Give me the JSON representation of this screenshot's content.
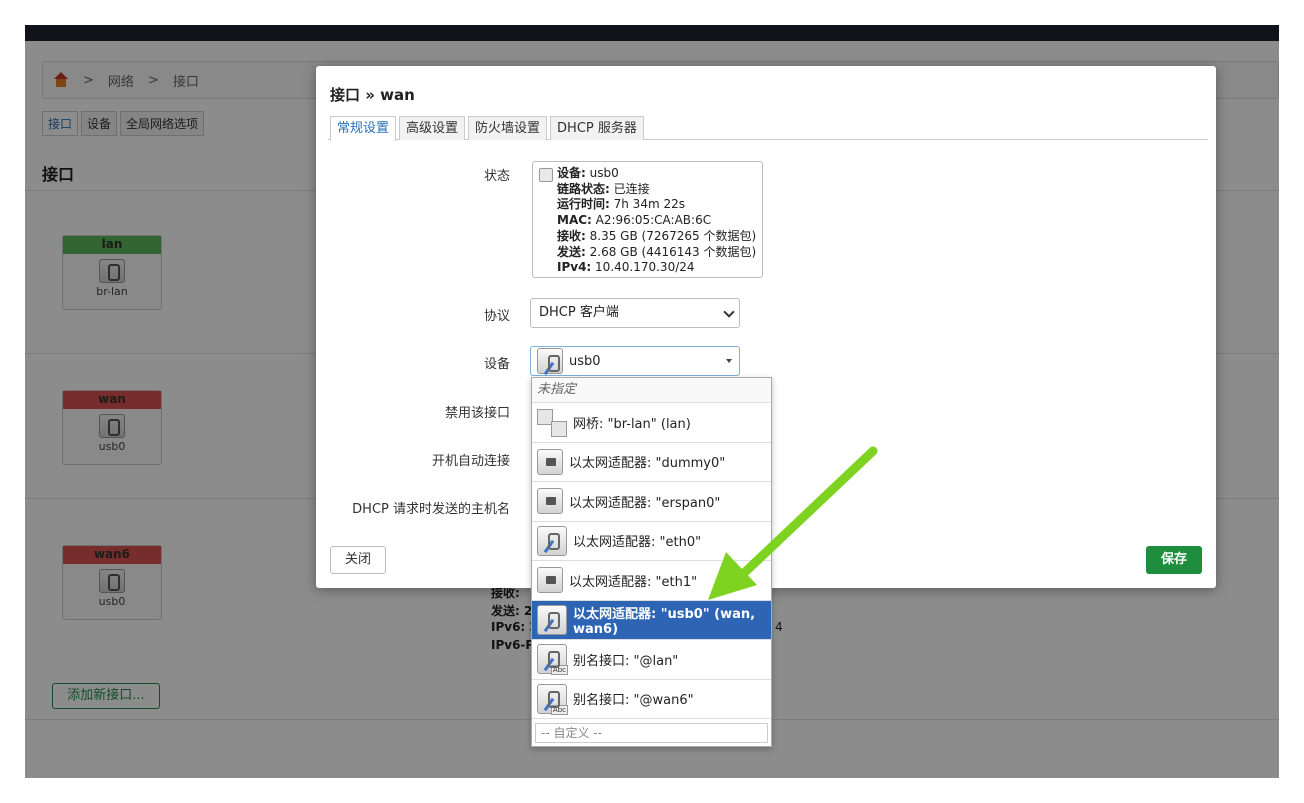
{
  "breadcrumb": {
    "sep": ">",
    "items": [
      "网络",
      "接口"
    ]
  },
  "page_tabs": [
    "接口",
    "设备",
    "全局网络选项"
  ],
  "page_title": "接口",
  "interfaces": [
    {
      "name": "lan",
      "device": "br-lan",
      "color": "#5cb85c"
    },
    {
      "name": "wan",
      "device": "usb0",
      "color": "#d9534f"
    },
    {
      "name": "wan6",
      "device": "usb0",
      "color": "#d9534f"
    }
  ],
  "background_text": {
    "line1": "接收: ",
    "line2": "发送: 2",
    "line3": "IPv6: 2",
    "line4": "IPv6-P",
    "tail": "4"
  },
  "add_button": "添加新接口...",
  "modal": {
    "title": "接口 » wan",
    "tabs": [
      "常规设置",
      "高级设置",
      "防火墙设置",
      "DHCP 服务器"
    ],
    "labels": {
      "status": "状态",
      "protocol": "协议",
      "device": "设备",
      "disable": "禁用该接口",
      "autostart": "开机自动连接",
      "hostname": "DHCP 请求时发送的主机名"
    },
    "status": {
      "device_k": "设备:",
      "device_v": " usb0",
      "link_k": "链路状态:",
      "link_v": " 已连接",
      "uptime_k": "运行时间:",
      "uptime_v": " 7h 34m 22s",
      "mac_k": "MAC:",
      "mac_v": " A2:96:05:CA:AB:6C",
      "rx_k": "接收:",
      "rx_v": " 8.35 GB (7267265 个数据包)",
      "tx_k": "发送:",
      "tx_v": " 2.68 GB (4416143 个数据包)",
      "ipv4_k": "IPv4:",
      "ipv4_v": " 10.40.170.30/24"
    },
    "protocol_value": "DHCP 客户端",
    "device_value": "usb0",
    "close": "关闭",
    "save": "保存"
  },
  "dropdown": {
    "unspecified": "未指定",
    "options": [
      {
        "label": "网桥: \"br-lan\" (lan)",
        "icon": "bridge-icon"
      },
      {
        "label": "以太网适配器: \"dummy0\"",
        "icon": "ethernet-chip-icon"
      },
      {
        "label": "以太网适配器: \"erspan0\"",
        "icon": "ethernet-chip-icon"
      },
      {
        "label": "以太网适配器: \"eth0\"",
        "icon": "ethernet-port-icon"
      },
      {
        "label": "以太网适配器: \"eth1\"",
        "icon": "ethernet-chip-icon"
      },
      {
        "label": "以太网适配器: \"usb0\" (wan, wan6)",
        "icon": "ethernet-port-icon",
        "selected": true
      },
      {
        "label": "别名接口: \"@lan\"",
        "icon": "alias-icon"
      },
      {
        "label": "别名接口: \"@wan6\"",
        "icon": "alias-icon"
      }
    ],
    "custom_placeholder": "-- 自定义 --"
  },
  "annotation": {
    "color": "#7ed321"
  }
}
